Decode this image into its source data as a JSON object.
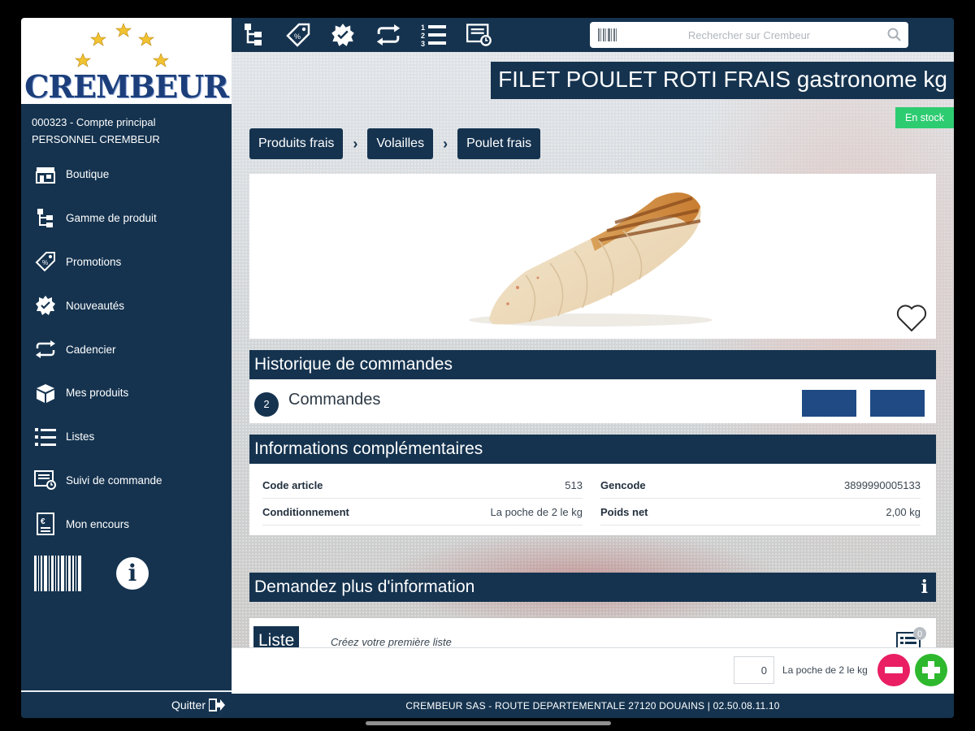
{
  "brand": {
    "name": "CREMBEUR"
  },
  "account": {
    "line1": "000323 - Compte principal",
    "line2": "PERSONNEL CREMBEUR"
  },
  "sidebar": {
    "items": [
      {
        "label": "Boutique",
        "icon": "shop-icon"
      },
      {
        "label": "Gamme de produit",
        "icon": "hierarchy-icon"
      },
      {
        "label": "Promotions",
        "icon": "promo-tag-icon"
      },
      {
        "label": "Nouveautés",
        "icon": "new-badge-icon"
      },
      {
        "label": "Cadencier",
        "icon": "repeat-icon"
      },
      {
        "label": "Mes produits",
        "icon": "box-icon"
      },
      {
        "label": "Listes",
        "icon": "list-icon"
      },
      {
        "label": "Suivi de commande",
        "icon": "order-tracking-icon"
      },
      {
        "label": "Mon encours",
        "icon": "account-statement-icon"
      }
    ],
    "quit_label": "Quitter"
  },
  "search": {
    "placeholder": "Rechercher sur Crembeur"
  },
  "product": {
    "title": "FILET POULET ROTI FRAIS gastronome kg",
    "stock_status": "En stock",
    "breadcrumb": [
      "Produits frais",
      "Volailles",
      "Poulet frais"
    ]
  },
  "orders": {
    "heading": "Historique de commandes",
    "count": "2",
    "label": "Commandes"
  },
  "info": {
    "heading": "Informations complémentaires",
    "rows": [
      {
        "key": "Code article",
        "value": "513"
      },
      {
        "key": "Gencode",
        "value": "3899990005133"
      },
      {
        "key": "Conditionnement",
        "value": "La poche de 2 le kg"
      },
      {
        "key": "Poids net",
        "value": "2,00 kg"
      }
    ]
  },
  "request": {
    "heading": "Demandez plus d'information"
  },
  "lists": {
    "tag": "Liste",
    "text": "Créez votre première liste",
    "badge": "0"
  },
  "cart": {
    "quantity": "0",
    "unit": "La poche de 2 le kg"
  },
  "footer": {
    "text": "CREMBEUR SAS - ROUTE DEPARTEMENTALE 27120 DOUAINS | 02.50.08.11.10"
  },
  "colors": {
    "navy": "#15334f",
    "accent_blue": "#1f4a84",
    "stock_green": "#2ecc71",
    "minus_red": "#e91e63",
    "plus_green": "#2eb82e"
  }
}
